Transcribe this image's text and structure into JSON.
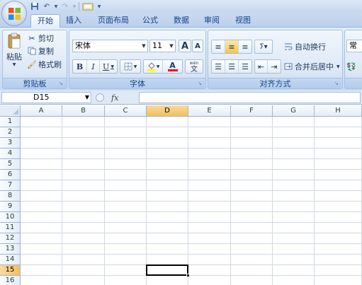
{
  "ribbon_tabs": [
    {
      "label": "开始",
      "active": true
    },
    {
      "label": "插入",
      "active": false
    },
    {
      "label": "页面布局",
      "active": false
    },
    {
      "label": "公式",
      "active": false
    },
    {
      "label": "数据",
      "active": false
    },
    {
      "label": "审阅",
      "active": false
    },
    {
      "label": "视图",
      "active": false
    }
  ],
  "clipboard": {
    "label": "剪贴板",
    "paste_label": "粘贴",
    "cut_label": "剪切",
    "copy_label": "复制",
    "format_painter_label": "格式刷"
  },
  "font": {
    "label": "字体",
    "font_name": "宋体",
    "font_size": "11",
    "bold": "B",
    "italic": "I",
    "underline": "U",
    "grow_font": "A",
    "shrink_font": "A",
    "font_color_glyph": "A",
    "phonetic_top": "wén",
    "phonetic_bottom": "文"
  },
  "alignment": {
    "label": "对齐方式",
    "wrap_text_label": "自动换行",
    "merge_center_label": "合并后居中"
  },
  "number": {
    "partial_label": "常"
  },
  "formula_bar": {
    "name_box_value": "D15",
    "fx_label": "fx",
    "formula_value": ""
  },
  "sheet": {
    "columns": [
      "A",
      "B",
      "C",
      "D",
      "E",
      "F",
      "G",
      "H"
    ],
    "rows": [
      "1",
      "2",
      "3",
      "4",
      "5",
      "6",
      "7",
      "8",
      "9",
      "10",
      "11",
      "12",
      "13",
      "14",
      "15",
      "16"
    ],
    "selected_column": "D",
    "selected_row": "15"
  },
  "colors": {
    "accent_selected": "#f1c15f",
    "ribbon_text": "#15428b"
  }
}
